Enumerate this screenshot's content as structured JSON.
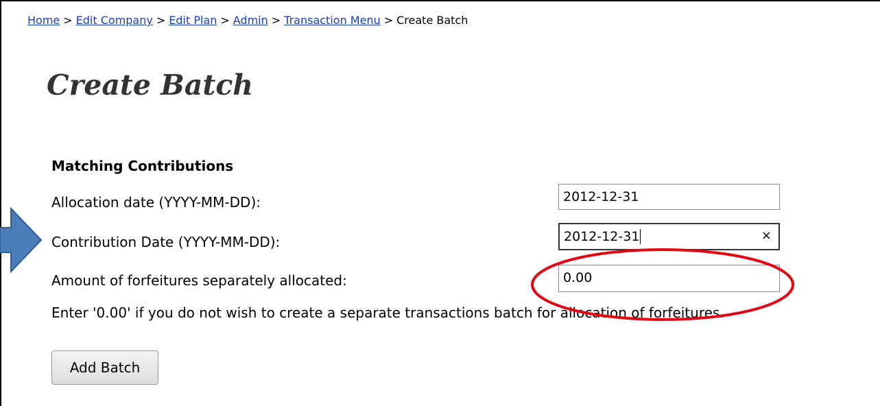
{
  "breadcrumb": {
    "items": [
      "Home",
      "Edit Company",
      "Edit Plan",
      "Admin",
      "Transaction Menu"
    ],
    "separator": ">",
    "current": "Create Batch"
  },
  "page": {
    "title": "Create Batch"
  },
  "form": {
    "section_heading": "Matching Contributions",
    "allocation_label": "Allocation date (YYYY-MM-DD):",
    "allocation_value": "2012-12-31",
    "contribution_label": "Contribution Date (YYYY-MM-DD):",
    "contribution_value": "2012-12-31",
    "contribution_clear": "×",
    "forfeitures_label": "Amount of forfeitures separately allocated:",
    "forfeitures_value": "0.00",
    "note": "Enter '0.00' if you do not wish to create a separate transactions batch for allocation of forfeitures.",
    "submit_label": "Add Batch"
  },
  "annotations": {
    "arrow_color": "#4a7ebb",
    "ellipse_color": "#e30613"
  }
}
